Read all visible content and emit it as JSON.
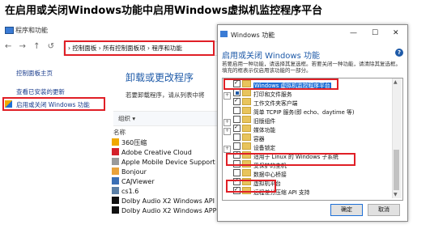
{
  "heading": "在启用或关闭Windows功能中启用Windows虚拟机监控程序平台",
  "control_panel": {
    "window_title": "程序和功能",
    "nav_arrows": "←  →  ↑  ↺",
    "breadcrumb": "›  控制面板  ›  所有控制面板项  ›  程序和功能",
    "sidebar": [
      "控制面板主页",
      "查看已安装的更新",
      "启用或关闭 Windows 功能"
    ],
    "main_title": "卸载或更改程序",
    "main_desc": "若要卸载程序，请从列表中将",
    "organize": "组织 ▾",
    "name_column": "名称",
    "programs": [
      {
        "name": "360压缩",
        "color": "#f0a800"
      },
      {
        "name": "Adobe Creative Cloud",
        "color": "#d4202a"
      },
      {
        "name": "Apple Mobile Device Support",
        "color": "#9a9a9a"
      },
      {
        "name": "Bonjour",
        "color": "#e9a23b"
      },
      {
        "name": "CAJViewer",
        "color": "#3a6fb5"
      },
      {
        "name": "cs1.6",
        "color": "#5a7fa6"
      },
      {
        "name": "Dolby Audio X2 Windows API",
        "color": "#111111"
      },
      {
        "name": "Dolby Audio X2 Windows APP",
        "color": "#111111"
      }
    ]
  },
  "dialog": {
    "title": "Windows 功能",
    "window_buttons": [
      "—",
      "☐",
      "✕"
    ],
    "heading": "启用或关闭 Windows 功能",
    "help": "?",
    "description": "若要启用一种功能，请选择其复选框。若要关闭一种功能，请清除其复选框。填充的框表示仅启用该功能的一部分。",
    "features": [
      {
        "label": "Windows 虚拟机监控程序平台",
        "state": "checked",
        "expand": false,
        "selected": true
      },
      {
        "label": "打印和文件服务",
        "state": "partial",
        "expand": true
      },
      {
        "label": "工作文件夹客户端",
        "state": "checked",
        "expand": false
      },
      {
        "label": "简单 TCPIP 服务(即 echo、daytime 等)",
        "state": "none",
        "expand": false
      },
      {
        "label": "旧版组件",
        "state": "none",
        "expand": true
      },
      {
        "label": "媒体功能",
        "state": "checked",
        "expand": true
      },
      {
        "label": "容器",
        "state": "none",
        "expand": false
      },
      {
        "label": "设备锁定",
        "state": "none",
        "expand": true
      },
      {
        "label": "适用于 Linux 的 Windows 子系统",
        "state": "checked",
        "expand": false
      },
      {
        "label": "受保护的主机",
        "state": "none",
        "expand": false
      },
      {
        "label": "数据中心桥接",
        "state": "none",
        "expand": false
      },
      {
        "label": "虚拟机平台",
        "state": "checked",
        "expand": false
      },
      {
        "label": "远程差分压缩 API 支持",
        "state": "checked",
        "expand": false
      }
    ],
    "ok": "确定",
    "cancel": "取消"
  },
  "colors": {
    "highlight_red": "#e01f26",
    "link_blue": "#1e5aa8",
    "selection_blue": "#1e6fd6"
  }
}
